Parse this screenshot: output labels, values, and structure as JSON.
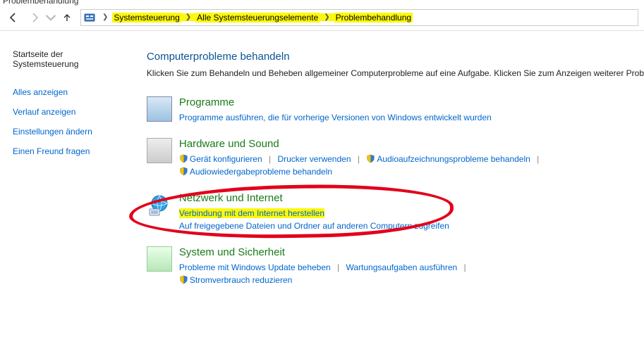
{
  "window": {
    "title_partial": "Problembehandlung"
  },
  "breadcrumb": {
    "items": [
      "Systemsteuerung",
      "Alle Systemsteuerungselemente",
      "Problembehandlung"
    ]
  },
  "sidebar": {
    "home": "Startseite der Systemsteuerung",
    "links": [
      "Alles anzeigen",
      "Verlauf anzeigen",
      "Einstellungen ändern",
      "Einen Freund fragen"
    ]
  },
  "page": {
    "title": "Computerprobleme behandeln",
    "subtitle": "Klicken Sie zum Behandeln und Beheben allgemeiner Computerprobleme auf eine Aufgabe. Klicken Sie zum Anzeigen weiterer Prob"
  },
  "categories": {
    "programs": {
      "title": "Programme",
      "link1": "Programme ausführen, die für vorherige Versionen von Windows entwickelt wurden"
    },
    "hardware": {
      "title": "Hardware und Sound",
      "link1": "Gerät konfigurieren",
      "link2": "Drucker verwenden",
      "link3": "Audioaufzeichnungsprobleme behandeln",
      "link4": "Audiowiedergabeprobleme behandeln"
    },
    "network": {
      "title": "Netzwerk und Internet",
      "link1": "Verbindung mit dem Internet herstellen",
      "link2": "Auf freigegebene Dateien und Ordner auf anderen Computern zugreifen"
    },
    "system": {
      "title": "System und Sicherheit",
      "link1": "Probleme mit Windows Update beheben",
      "link2": "Wartungsaufgaben ausführen",
      "link3": "Stromverbrauch reduzieren"
    }
  }
}
